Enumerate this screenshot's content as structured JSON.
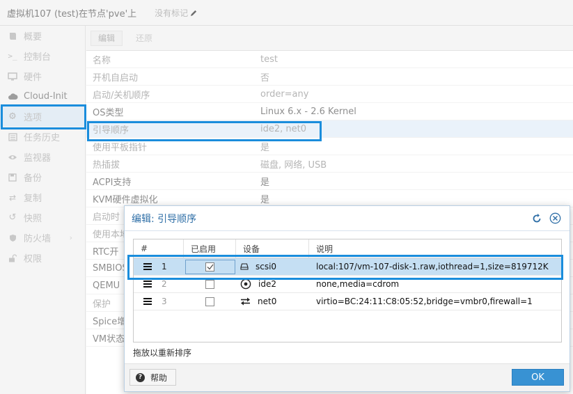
{
  "window": {
    "title": "虚拟机107 (test)在节点'pve'上",
    "notes_label": "没有标记"
  },
  "sidebar": {
    "items": [
      {
        "label": "概要",
        "icon": "book-icon"
      },
      {
        "label": "控制台",
        "icon": "terminal-icon"
      },
      {
        "label": "硬件",
        "icon": "monitor-icon"
      },
      {
        "label": "Cloud-Init",
        "icon": "cloud-icon"
      },
      {
        "label": "选项",
        "icon": "gear-icon"
      },
      {
        "label": "任务历史",
        "icon": "list-icon"
      },
      {
        "label": "监视器",
        "icon": "eye-icon"
      },
      {
        "label": "备份",
        "icon": "floppy-icon"
      },
      {
        "label": "复制",
        "icon": "retweet-icon"
      },
      {
        "label": "快照",
        "icon": "history-icon"
      },
      {
        "label": "防火墙",
        "icon": "shield-icon"
      },
      {
        "label": "权限",
        "icon": "unlock-icon"
      }
    ]
  },
  "toolbar": {
    "edit_label": "编辑",
    "revert_label": "还原"
  },
  "options": {
    "rows": [
      {
        "key": "名称",
        "value": "test"
      },
      {
        "key": "开机自启动",
        "value": "否"
      },
      {
        "key": "启动/关机顺序",
        "value": "order=any"
      },
      {
        "key": "OS类型",
        "value": "Linux 6.x - 2.6 Kernel"
      },
      {
        "key": "引导顺序",
        "value": "ide2, net0"
      },
      {
        "key": "使用平板指针",
        "value": "是"
      },
      {
        "key": "热插拔",
        "value": "磁盘, 网络, USB"
      },
      {
        "key": "ACPI支持",
        "value": "是"
      },
      {
        "key": "KVM硬件虚拟化",
        "value": "是"
      },
      {
        "key": "启动时",
        "value": ""
      },
      {
        "key": "使用本地",
        "value": ""
      },
      {
        "key": "RTC开",
        "value": ""
      },
      {
        "key": "SMBIOS",
        "value": ""
      },
      {
        "key": "QEMU",
        "value": ""
      },
      {
        "key": "保护",
        "value": ""
      },
      {
        "key": "Spice增",
        "value": ""
      },
      {
        "key": "VM状态",
        "value": ""
      }
    ]
  },
  "dialog": {
    "title": "编辑: 引导顺序",
    "columns": {
      "order": "#",
      "enabled": "已启用",
      "device": "设备",
      "description": "说明"
    },
    "rows": [
      {
        "order": "1",
        "device": "scsi0",
        "icon": "hdd-icon",
        "description": "local:107/vm-107-disk-1.raw,iothread=1,size=819712K",
        "enabled": true
      },
      {
        "order": "2",
        "device": "ide2",
        "icon": "disc-icon",
        "description": "none,media=cdrom",
        "enabled": false
      },
      {
        "order": "3",
        "device": "net0",
        "icon": "exchange-icon",
        "description": "virtio=BC:24:11:C8:05:52,bridge=vmbr0,firewall=1",
        "enabled": false
      }
    ],
    "hint": "拖放以重新排序",
    "help_label": "帮助",
    "ok_label": "OK"
  },
  "colors": {
    "highlight": "#1a8ddc",
    "ok_button": "#3892d3",
    "selected_row": "#c5dff3"
  }
}
